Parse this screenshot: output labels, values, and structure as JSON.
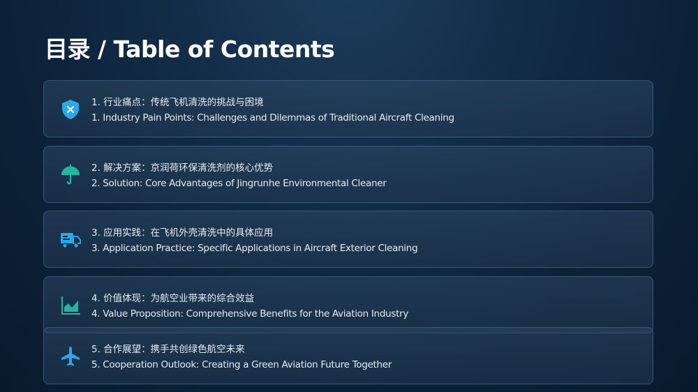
{
  "title": "目录 / Table of Contents",
  "items": [
    {
      "zh": "1. 行业痛点：传统飞机清洗的挑战与困境",
      "en": "1. Industry Pain Points: Challenges and Dilemmas of Traditional Aircraft Cleaning",
      "icon": "shield-x-icon",
      "color": "#2aa8e8"
    },
    {
      "zh": "2. 解决方案：京润荷环保清洗剂的核心优势",
      "en": "2. Solution: Core Advantages of Jingrunhe Environmental Cleaner",
      "icon": "umbrella-icon",
      "color": "#20b8a4"
    },
    {
      "zh": "3. 应用实践：在飞机外壳清洗中的具体应用",
      "en": "3. Application Practice: Specific Applications in Aircraft Exterior Cleaning",
      "icon": "truck-icon",
      "color": "#2aa8e8"
    },
    {
      "zh": "4. 价值体现：为航空业带来的综合效益",
      "en": "4. Value Proposition: Comprehensive Benefits for the Aviation Industry",
      "icon": "area-chart-icon",
      "color": "#20b8a4"
    },
    {
      "zh": "5. 合作展望：携手共创绿色航空未来",
      "en": "5. Cooperation Outlook: Creating a Green Aviation Future Together",
      "icon": "airplane-icon",
      "color": "#2aa8e8"
    }
  ]
}
